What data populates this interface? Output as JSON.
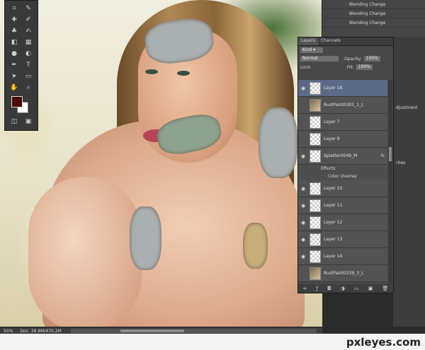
{
  "layers_panel": {
    "tabs": [
      "Layers",
      "Channels"
    ],
    "filter_label": "Kind",
    "blend_mode": "Normal",
    "opacity_label": "Opacity:",
    "opacity_value": "100%",
    "lock_label": "Lock:",
    "fill_label": "Fill:",
    "fill_value": "100%",
    "layers": [
      {
        "name": "Layer 18",
        "selected": true,
        "visible": true,
        "thumb": "transparent"
      },
      {
        "name": "RustPaint0301_1_L",
        "selected": false,
        "visible": false,
        "thumb": "image"
      },
      {
        "name": "Layer 7",
        "selected": false,
        "visible": false,
        "thumb": "transparent"
      },
      {
        "name": "Layer 9",
        "selected": false,
        "visible": false,
        "thumb": "transparent"
      },
      {
        "name": "Splatter0049_M",
        "selected": false,
        "visible": true,
        "thumb": "transparent",
        "fx": "fx"
      },
      {
        "name": "Layer 10",
        "selected": false,
        "visible": true,
        "thumb": "transparent"
      },
      {
        "name": "Layer 11",
        "selected": false,
        "visible": true,
        "thumb": "transparent"
      },
      {
        "name": "Layer 12",
        "selected": false,
        "visible": true,
        "thumb": "transparent"
      },
      {
        "name": "Layer 13",
        "selected": false,
        "visible": true,
        "thumb": "transparent"
      },
      {
        "name": "Layer 14",
        "selected": false,
        "visible": true,
        "thumb": "transparent"
      },
      {
        "name": "RustPaint0239_3_L",
        "selected": false,
        "visible": false,
        "thumb": "image"
      }
    ],
    "effects_label": "Effects",
    "color_overlay_label": "Color Overlay"
  },
  "history_panel": {
    "items": [
      "Blending Change",
      "Blending Change",
      "Blending Change"
    ]
  },
  "right_strip": {
    "adjustments_label": "djustment",
    "properties_label": "rties"
  },
  "status_bar": {
    "zoom": "50%",
    "doc_info": "Doc: 28.8M/470.2M"
  },
  "watermark": "pxleyes.com",
  "colors": {
    "foreground": "#4b0a08",
    "background": "#ffffff"
  }
}
